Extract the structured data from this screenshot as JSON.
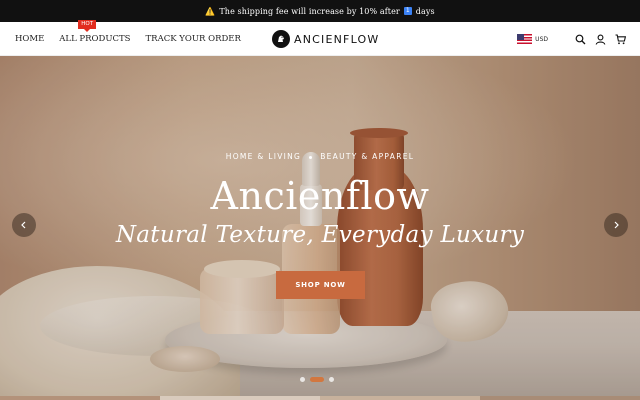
{
  "announcement": {
    "warning_icon": "⚠️",
    "text_before": "The shipping fee will increase by 10% after",
    "days_number": "1",
    "text_after": "days"
  },
  "nav": {
    "home": "HOME",
    "all_products": "ALL PRODUCTS",
    "hot_badge": "HOT",
    "track_order": "TRACK YOUR ORDER"
  },
  "logo": {
    "text": "ANCIENFLOW"
  },
  "header_tools": {
    "currency": "USD",
    "flag_icon": "us-flag-icon",
    "search_icon": "search-icon",
    "account_icon": "user-icon",
    "cart_icon": "cart-icon"
  },
  "hero": {
    "tag_left": "HOME & LIVING",
    "tag_right": "BEAUTY & APPAREL",
    "title": "Ancienflow",
    "subtitle": "Natural Texture, Everyday Luxury",
    "cta": "SHOP NOW",
    "cta_color": "#c86a3f",
    "slides": 3,
    "active_slide": 2
  },
  "colors": {
    "announcement_bg": "#111111",
    "hot_badge": "#e22d1f",
    "accent": "#c86a3f"
  }
}
